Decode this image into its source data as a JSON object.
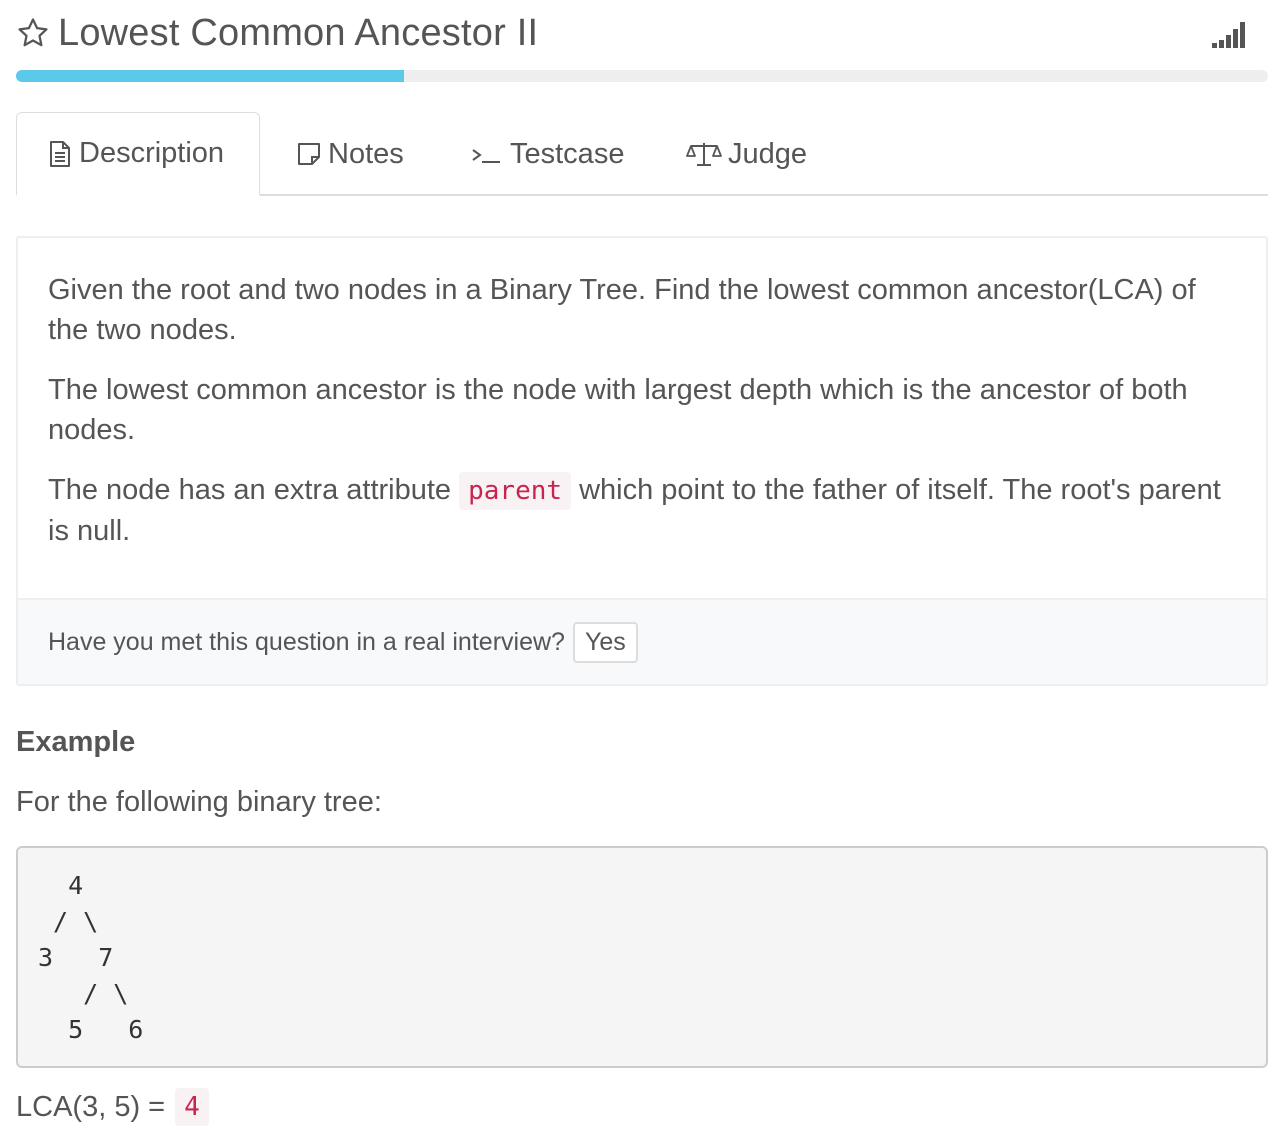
{
  "problem": {
    "title": "Lowest Common Ancestor II",
    "progress_fraction": 0.31
  },
  "tabs": [
    {
      "label": "Description",
      "icon": "document-icon",
      "active": true
    },
    {
      "label": "Notes",
      "icon": "note-icon",
      "active": false
    },
    {
      "label": "Testcase",
      "icon": "terminal-icon",
      "active": false
    },
    {
      "label": "Judge",
      "icon": "scale-icon",
      "active": false
    }
  ],
  "description": {
    "p1": "Given the root and two nodes in a Binary Tree. Find the lowest common ancestor(LCA) of the two nodes.",
    "p2": "The lowest common ancestor is the node with largest depth which is the ancestor of both nodes.",
    "p3_before": "The node has an extra attribute",
    "p3_code": "parent",
    "p3_after": "which point to the father of itself. The root's parent is null."
  },
  "interview": {
    "question": "Have you met this question in a real interview?",
    "yes_label": "Yes"
  },
  "example": {
    "heading": "Example",
    "intro": "For the following binary tree:",
    "tree": "  4\n / \\\n3   7\n   / \\\n  5   6",
    "lca_expr": "LCA(3, 5) =",
    "lca_result": "4"
  },
  "colors": {
    "accent": "#5bc9ea",
    "code_text": "#c7254e",
    "code_bg": "#f9f2f4"
  }
}
